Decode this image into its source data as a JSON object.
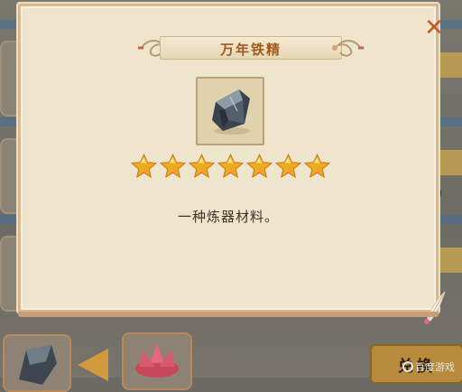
{
  "dialog": {
    "title": "万年铁精",
    "description": "一种炼器材料。",
    "star_count": 7,
    "item_icon": "iron-ore-icon",
    "close_icon": "close-icon"
  },
  "background": {
    "side_number": "0",
    "exchange_button_label": "兑换"
  },
  "watermark": {
    "text": "百度游戏"
  },
  "colors": {
    "dialog_bg": "#efe5cc",
    "title_text": "#a25a1f",
    "star": "#f0a820",
    "close": "#c2592b"
  }
}
